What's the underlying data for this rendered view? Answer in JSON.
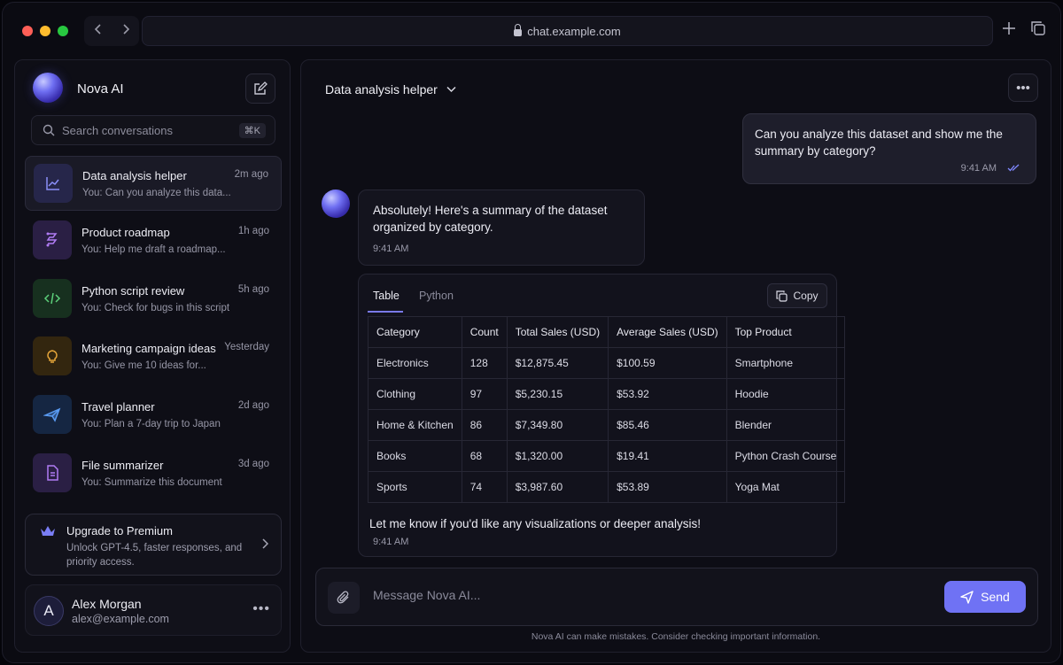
{
  "browser": {
    "url": "chat.example.com",
    "back_icon": "chevron-left",
    "forward_icon": "chevron-right",
    "new_tab_icon": "plus",
    "tabs_icon": "copy"
  },
  "sidebar": {
    "brand": "Nova AI",
    "search_placeholder": "Search conversations",
    "search_shortcut": "⌘K",
    "conversations": [
      {
        "title": "Data analysis helper",
        "preview": "You: Can you analyze this data...",
        "time": "2m ago",
        "icon": "chart-icon",
        "accent": "#8a8ef8",
        "active": true
      },
      {
        "title": "Product roadmap",
        "preview": "You: Help me draft a roadmap...",
        "time": "1h ago",
        "icon": "roadmap-icon",
        "accent": "#b07cf4"
      },
      {
        "title": "Python script review",
        "preview": "You: Check for bugs in this script",
        "time": "5h ago",
        "icon": "code-icon",
        "accent": "#5ccf7a"
      },
      {
        "title": "Marketing campaign ideas",
        "preview": "You: Give me 10 ideas for...",
        "time": "Yesterday",
        "icon": "lightbulb-icon",
        "accent": "#e6a63a"
      },
      {
        "title": "Travel planner",
        "preview": "You: Plan a 7-day trip to Japan",
        "time": "2d ago",
        "icon": "plane-icon",
        "accent": "#5a9cf4"
      },
      {
        "title": "File summarizer",
        "preview": "You: Summarize this document",
        "time": "3d ago",
        "icon": "document-icon",
        "accent": "#b07cf4"
      }
    ],
    "upgrade": {
      "title": "Upgrade to Premium",
      "description": "Unlock GPT-4.5, faster responses, and priority access."
    },
    "user": {
      "initial": "A",
      "name": "Alex Morgan",
      "email": "alex@example.com"
    }
  },
  "main": {
    "chat_title": "Data analysis helper",
    "user_message": {
      "text": "Can you analyze this dataset and show me the summary by category?",
      "time": "9:41 AM"
    },
    "ai_message": {
      "text": "Absolutely! Here's a summary of the dataset organized by category.",
      "time": "9:41 AM"
    },
    "table_card": {
      "tabs": [
        "Table",
        "Python"
      ],
      "active_tab": "Table",
      "copy_label": "Copy",
      "columns": [
        "Category",
        "Count",
        "Total Sales (USD)",
        "Average Sales (USD)",
        "Top Product"
      ],
      "rows": [
        [
          "Electronics",
          "128",
          "$12,875.45",
          "$100.59",
          "Smartphone"
        ],
        [
          "Clothing",
          "97",
          "$5,230.15",
          "$53.92",
          "Hoodie"
        ],
        [
          "Home & Kitchen",
          "86",
          "$7,349.80",
          "$85.46",
          "Blender"
        ],
        [
          "Books",
          "68",
          "$1,320.00",
          "$19.41",
          "Python Crash Course"
        ],
        [
          "Sports",
          "74",
          "$3,987.60",
          "$53.89",
          "Yoga Mat"
        ]
      ],
      "closing_text": "Let me know if you'd like any visualizations or deeper analysis!",
      "closing_time": "9:41 AM"
    },
    "composer": {
      "placeholder": "Message Nova AI...",
      "send_label": "Send"
    },
    "disclaimer": "Nova AI can make mistakes. Consider checking important information."
  },
  "colors": {
    "accent": "#6f72f4",
    "background": "#0b0b12"
  }
}
